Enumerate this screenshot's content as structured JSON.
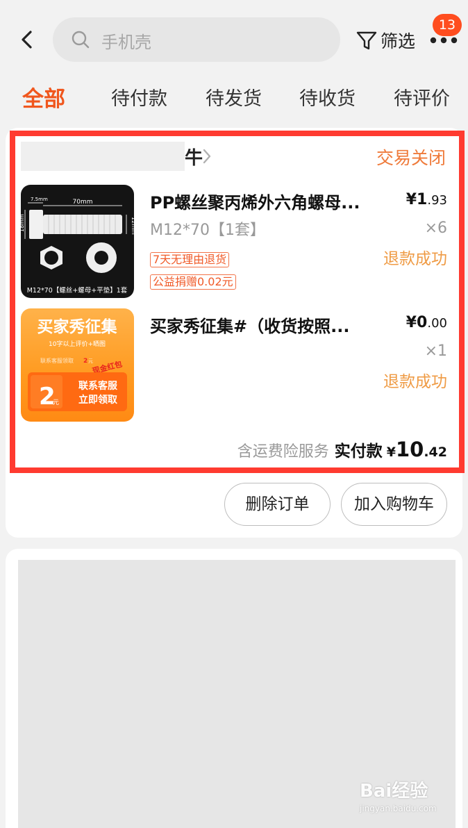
{
  "header": {
    "search_placeholder": "手机壳",
    "filter_label": "筛选",
    "badge_count": "13"
  },
  "tabs": [
    {
      "label": "全部",
      "active": true
    },
    {
      "label": "待付款",
      "active": false
    },
    {
      "label": "待发货",
      "active": false
    },
    {
      "label": "待收货",
      "active": false
    },
    {
      "label": "待评价",
      "active": false
    }
  ],
  "order": {
    "shop_name_tail": "牛",
    "status": "交易关闭",
    "items": [
      {
        "title": "PP螺丝聚丙烯外六角螺母...",
        "spec": "M12*70【1套】",
        "price_symbol": "¥",
        "price_int": "1",
        "price_dec": ".93",
        "qty": "×6",
        "refund": "退款成功",
        "tags": [
          "7天无理由退货",
          "公益捐赠0.02元"
        ],
        "image": {
          "dim_top": "70mm",
          "dim_left_top": "7.5mm",
          "dim_left": "18mm",
          "dim_right": "12mm",
          "caption": "M12*70【螺丝+螺母+平垫】1套"
        }
      },
      {
        "title": "买家秀征集#（收货按照...",
        "price_symbol": "¥",
        "price_int": "0",
        "price_dec": ".00",
        "qty": "×1",
        "refund": "退款成功",
        "image": {
          "headline": "买家秀征集",
          "sub": "10字以上评价+晒图",
          "sub2": "联系客服领取",
          "amount": "2",
          "amount_tail": "元",
          "corner": "现金红包",
          "coupon_amount": "2",
          "coupon_unit": "元",
          "cta1": "联系客服",
          "cta2": "立即领取"
        }
      }
    ],
    "total_note": "含运费险服务",
    "total_label": "实付款",
    "total_symbol": "¥",
    "total_int": "10",
    "total_dec": ".42"
  },
  "actions": {
    "delete_label": "删除订单",
    "cart_label": "加入购物车"
  },
  "watermark": {
    "main": "Bai经验",
    "sub": "jingyan.baidu.com"
  },
  "colors": {
    "accent": "#f0571e",
    "status": "#ef7a3a",
    "refund": "#ef9b45",
    "highlight": "#ff3b30",
    "badge": "#ff4d1f"
  }
}
